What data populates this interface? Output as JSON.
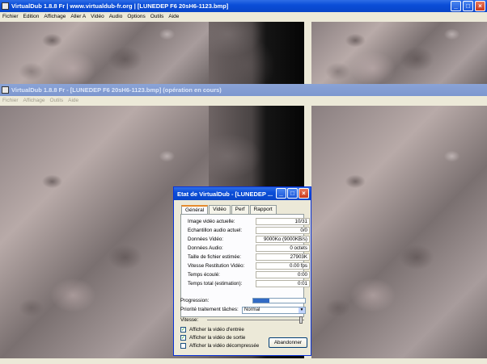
{
  "main_window": {
    "title": "VirtualDub 1.8.8 Fr | www.virtualdub-fr.org | [LUNEDEP F6 20sH6-1123.bmp]",
    "menu": [
      "Fichier",
      "Edition",
      "Affichage",
      "Aller A",
      "Vidéo",
      "Audio",
      "Options",
      "Outils",
      "Aide"
    ]
  },
  "second_window": {
    "title": "VirtualDub 1.8.8 Fr - [LUNEDEP F6 20sH6-1123.bmp] (opération en cours)",
    "menu": [
      "Fichier",
      "Affichage",
      "Outils",
      "Aide"
    ]
  },
  "dialog": {
    "title": "Etat de VirtualDub - [LUNEDEP ...",
    "tabs": [
      "Général",
      "Vidéo",
      "Perf",
      "Rapport"
    ],
    "stats": [
      {
        "label": "Image vidéo actuelle:",
        "value": "10/31"
      },
      {
        "label": "Echantillon audio actuel:",
        "value": "0/0"
      },
      {
        "label": "Données Vidéo:",
        "value": "9000Ko (9000KB/s)"
      },
      {
        "label": "Données Audio:",
        "value": "0 octets"
      },
      {
        "label": "Taille de fichier estimée:",
        "value": "27903K"
      },
      {
        "label": "Vitesse Restitution Vidéo:",
        "value": "0.00 fps"
      },
      {
        "label": "Temps écoulé:",
        "value": "0:00"
      },
      {
        "label": "Temps total (estimation):",
        "value": "0:01"
      }
    ],
    "progress_label": "Progression:",
    "progress_fraction": 0.32,
    "priority_label": "Priorité traitement tâches:",
    "priority_value": "Normal",
    "speed_label": "Vitesse:",
    "speed_fraction": 0.97,
    "checkboxes": [
      {
        "label": "Afficher la vidéo d'entrée",
        "checked": true
      },
      {
        "label": "Afficher la vidéo de sortie",
        "checked": true
      },
      {
        "label": "Afficher la vidéo décompressée",
        "checked": false
      }
    ],
    "abort_label": "Abandonner"
  }
}
